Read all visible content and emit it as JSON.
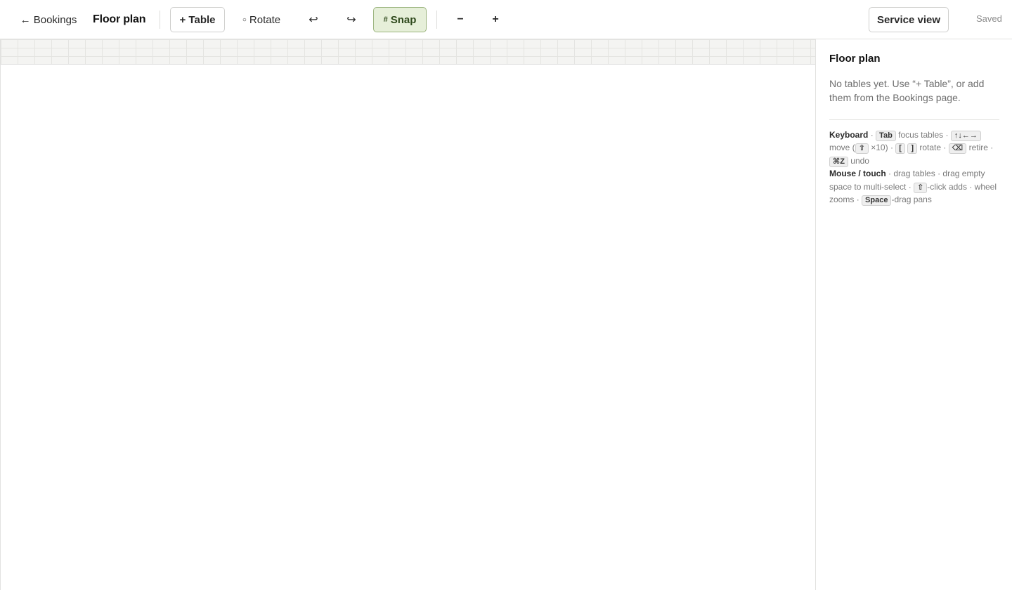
{
  "toolbar": {
    "back_label": "← Bookings",
    "title": "Floor plan",
    "add_table_label": "+ Table",
    "rotate_icon": "○",
    "rotate_label": "Rotate",
    "undo_glyph": "↩",
    "redo_glyph": "↪",
    "snap_icon": "#",
    "snap_label": "Snap",
    "zoom_out_label": "−",
    "zoom_in_label": "+",
    "service_view_label": "Service view",
    "status": "Saved",
    "snap_active_color": "#e6efd9"
  },
  "panel": {
    "title": "Floor plan",
    "empty_text": "No tables yet. Use “+ Table”, or add them from the Bookings page.",
    "help": {
      "keyboard_heading": "Keyboard",
      "sep": "·",
      "tab_key": "Tab",
      "focus_tables": "focus tables",
      "arrows_key": "↑↓←→",
      "move_open": "move (",
      "shift_key": "⇧",
      "times_ten": "×10)",
      "bracket_left_key": "[",
      "bracket_right_key": "]",
      "rotate": "rotate",
      "backspace_key": "⌫",
      "retire": "retire",
      "undo_key": "⌘Z",
      "undo": "undo",
      "mouse_heading": "Mouse / touch",
      "drag_tables": "drag tables",
      "drag_empty": "drag empty space to multi-select",
      "shift_key_2": "⇧",
      "click_adds": "-click adds",
      "wheel_zooms": "wheel zooms",
      "space_key": "Space",
      "drag_pans": "-drag pans"
    }
  }
}
